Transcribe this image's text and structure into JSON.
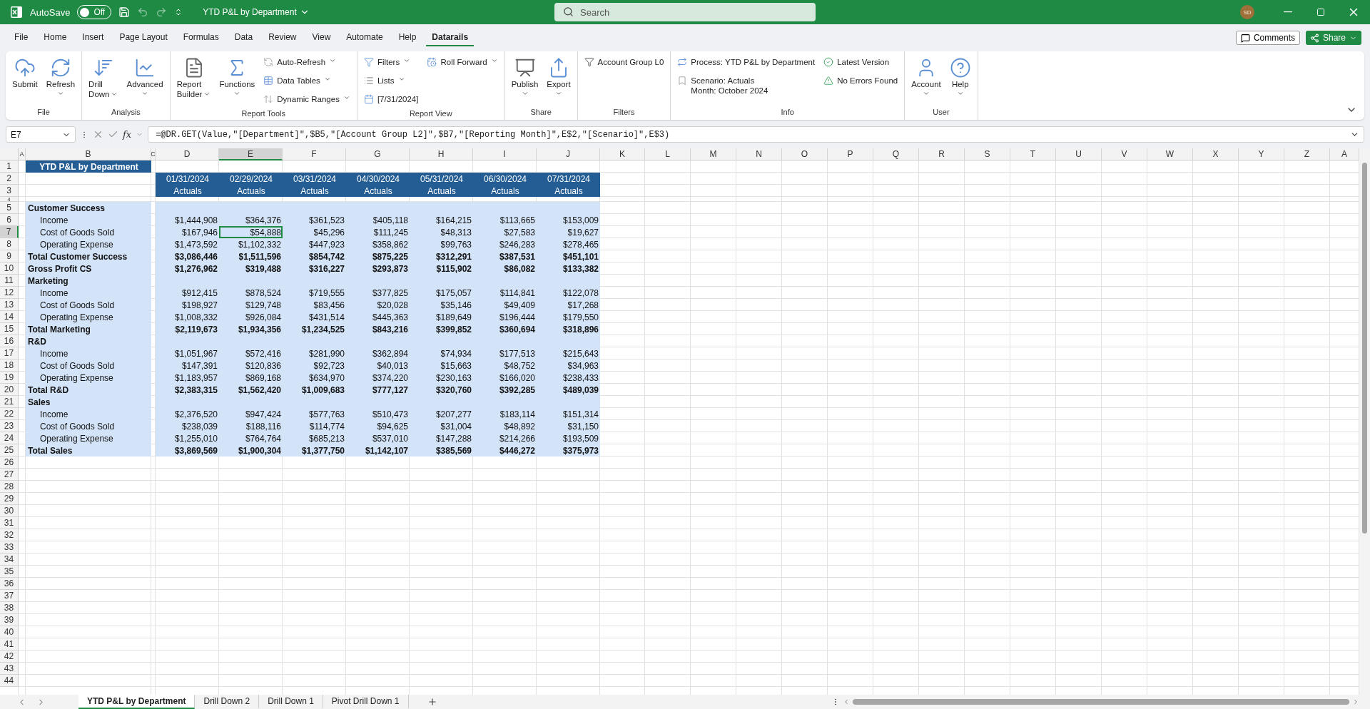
{
  "title_bar": {
    "autosave": {
      "label": "AutoSave",
      "state_text": "Off",
      "on": false
    },
    "document_title": "YTD P&L by Department",
    "search": {
      "placeholder": "Search"
    },
    "user_initials": "SD"
  },
  "menu_tabs": [
    {
      "label": "File",
      "selected": false
    },
    {
      "label": "Home",
      "selected": false
    },
    {
      "label": "Insert",
      "selected": false
    },
    {
      "label": "Page Layout",
      "selected": false
    },
    {
      "label": "Formulas",
      "selected": false
    },
    {
      "label": "Data",
      "selected": false
    },
    {
      "label": "Review",
      "selected": false
    },
    {
      "label": "View",
      "selected": false
    },
    {
      "label": "Automate",
      "selected": false
    },
    {
      "label": "Help",
      "selected": false
    },
    {
      "label": "Datarails",
      "selected": true
    }
  ],
  "comments_button": "Comments",
  "share_button": "Share",
  "ribbon": [
    {
      "label": "File",
      "columns": [
        [
          {
            "kind": "large",
            "lines": [
              "Submit"
            ],
            "dropdown": false
          }
        ],
        [
          {
            "kind": "large",
            "lines": [
              "Refresh"
            ],
            "dropdown": true
          }
        ]
      ]
    },
    {
      "label": "Analysis",
      "columns": [
        [
          {
            "kind": "large",
            "lines": [
              "Drill",
              "Down"
            ],
            "dropdown": true
          }
        ],
        [
          {
            "kind": "large",
            "lines": [
              "Advanced"
            ],
            "dropdown": true
          }
        ]
      ]
    },
    {
      "label": "Report Tools",
      "columns": [
        [
          {
            "kind": "large",
            "lines": [
              "Report",
              "Builder"
            ],
            "dropdown": true
          }
        ],
        [
          {
            "kind": "large",
            "lines": [
              "Functions"
            ],
            "dropdown": true
          }
        ],
        [
          {
            "kind": "small",
            "lines": [
              "Auto-Refresh"
            ],
            "dropdown": true
          },
          {
            "kind": "small",
            "lines": [
              "Data Tables"
            ],
            "dropdown": true
          },
          {
            "kind": "small",
            "lines": [
              "Dynamic Ranges"
            ],
            "dropdown": true
          }
        ]
      ]
    },
    {
      "label": "Report View",
      "columns": [
        [
          {
            "kind": "small",
            "lines": [
              "Filters"
            ],
            "dropdown": true
          },
          {
            "kind": "small",
            "lines": [
              "Lists"
            ],
            "dropdown": true
          },
          {
            "kind": "small",
            "lines": [
              "[7/31/2024]"
            ],
            "dropdown": false
          }
        ],
        [
          {
            "kind": "small",
            "lines": [
              "Roll Forward"
            ],
            "dropdown": true
          }
        ]
      ]
    },
    {
      "label": "Share",
      "columns": [
        [
          {
            "kind": "large",
            "lines": [
              "Publish"
            ],
            "dropdown": true
          }
        ],
        [
          {
            "kind": "large",
            "lines": [
              "Export"
            ],
            "dropdown": true
          }
        ]
      ]
    },
    {
      "label": "Filters",
      "columns": [
        [
          {
            "kind": "small",
            "lines": [
              "Account Group L0"
            ],
            "dropdown": false
          }
        ]
      ]
    },
    {
      "label": "Info",
      "columns": [
        [
          {
            "kind": "info",
            "lines": [
              "Process: YTD P&L by Department"
            ],
            "dropdown": false
          },
          {
            "kind": "info",
            "lines": [
              "Scenario: Actuals",
              "Month: October 2024"
            ],
            "dropdown": false
          }
        ],
        [
          {
            "kind": "info",
            "lines": [
              "Latest Version"
            ],
            "dropdown": false
          },
          {
            "kind": "info",
            "lines": [
              "No Errors Found"
            ],
            "dropdown": false
          }
        ]
      ]
    },
    {
      "label": "User",
      "columns": [
        [
          {
            "kind": "large",
            "lines": [
              "Account"
            ],
            "dropdown": true
          }
        ],
        [
          {
            "kind": "large",
            "lines": [
              "Help"
            ],
            "dropdown": true
          }
        ]
      ]
    }
  ],
  "formula_bar": {
    "name_box": "E7",
    "function_label": "fx",
    "formula": "=@DR.GET(Value,\"[Department]\",$B5,\"[Account Group L2]\",$B7,\"[Reporting Month]\",E$2,\"[Scenario]\",E$3)"
  },
  "sheet": {
    "columns": [
      {
        "label": "A",
        "selected": false
      },
      {
        "label": "B",
        "selected": false
      },
      {
        "label": "C",
        "selected": false
      },
      {
        "label": "D",
        "selected": false
      },
      {
        "label": "E",
        "selected": true
      },
      {
        "label": "F",
        "selected": false
      },
      {
        "label": "G",
        "selected": false
      },
      {
        "label": "H",
        "selected": false
      },
      {
        "label": "I",
        "selected": false
      },
      {
        "label": "J",
        "selected": false
      },
      {
        "label": "K",
        "selected": false
      },
      {
        "label": "L",
        "selected": false
      },
      {
        "label": "M",
        "selected": false
      },
      {
        "label": "N",
        "selected": false
      },
      {
        "label": "O",
        "selected": false
      },
      {
        "label": "P",
        "selected": false
      },
      {
        "label": "Q",
        "selected": false
      },
      {
        "label": "R",
        "selected": false
      },
      {
        "label": "S",
        "selected": false
      },
      {
        "label": "T",
        "selected": false
      },
      {
        "label": "U",
        "selected": false
      },
      {
        "label": "V",
        "selected": false
      },
      {
        "label": "W",
        "selected": false
      },
      {
        "label": "X",
        "selected": false
      },
      {
        "label": "Y",
        "selected": false
      },
      {
        "label": "Z",
        "selected": false
      },
      {
        "label": "A",
        "selected": false
      }
    ],
    "rows": [
      {
        "number": "1",
        "selected": false,
        "kind": "title",
        "label": "YTD P&L by Department"
      },
      {
        "number": "2",
        "selected": false,
        "kind": "header",
        "values": [
          "01/31/2024",
          "02/29/2024",
          "03/31/2024",
          "04/30/2024",
          "05/31/2024",
          "06/30/2024",
          "07/31/2024"
        ]
      },
      {
        "number": "3",
        "selected": false,
        "kind": "header",
        "values": [
          "Actuals",
          "Actuals",
          "Actuals",
          "Actuals",
          "Actuals",
          "Actuals",
          "Actuals"
        ]
      },
      {
        "number": "4",
        "selected": false,
        "kind": "spacer"
      },
      {
        "number": "5",
        "selected": false,
        "kind": "section",
        "label": "Customer Success"
      },
      {
        "number": "6",
        "selected": false,
        "kind": "line",
        "label": "Income",
        "values": [
          "$1,444,908",
          "$364,376",
          "$361,523",
          "$405,118",
          "$164,215",
          "$113,665",
          "$153,009"
        ]
      },
      {
        "number": "7",
        "selected": true,
        "kind": "line",
        "label": "Cost of Goods Sold",
        "values": [
          "$167,946",
          "$54,888",
          "$45,296",
          "$111,245",
          "$48,313",
          "$27,583",
          "$19,627"
        ]
      },
      {
        "number": "8",
        "selected": false,
        "kind": "line",
        "label": "Operating Expense",
        "values": [
          "$1,473,592",
          "$1,102,332",
          "$447,923",
          "$358,862",
          "$99,763",
          "$246,283",
          "$278,465"
        ]
      },
      {
        "number": "9",
        "selected": false,
        "kind": "total",
        "label": "Total Customer Success",
        "values": [
          "$3,086,446",
          "$1,511,596",
          "$854,742",
          "$875,225",
          "$312,291",
          "$387,531",
          "$451,101"
        ]
      },
      {
        "number": "10",
        "selected": false,
        "kind": "total",
        "label": "Gross Profit CS",
        "values": [
          "$1,276,962",
          "$319,488",
          "$316,227",
          "$293,873",
          "$115,902",
          "$86,082",
          "$133,382"
        ]
      },
      {
        "number": "11",
        "selected": false,
        "kind": "section",
        "label": "Marketing"
      },
      {
        "number": "12",
        "selected": false,
        "kind": "line",
        "label": "Income",
        "values": [
          "$912,415",
          "$878,524",
          "$719,555",
          "$377,825",
          "$175,057",
          "$114,841",
          "$122,078"
        ]
      },
      {
        "number": "13",
        "selected": false,
        "kind": "line",
        "label": "Cost of Goods Sold",
        "values": [
          "$198,927",
          "$129,748",
          "$83,456",
          "$20,028",
          "$35,146",
          "$49,409",
          "$17,268"
        ]
      },
      {
        "number": "14",
        "selected": false,
        "kind": "line",
        "label": "Operating Expense",
        "values": [
          "$1,008,332",
          "$926,084",
          "$431,514",
          "$445,363",
          "$189,649",
          "$196,444",
          "$179,550"
        ]
      },
      {
        "number": "15",
        "selected": false,
        "kind": "total",
        "label": "Total Marketing",
        "values": [
          "$2,119,673",
          "$1,934,356",
          "$1,234,525",
          "$843,216",
          "$399,852",
          "$360,694",
          "$318,896"
        ]
      },
      {
        "number": "16",
        "selected": false,
        "kind": "section",
        "label": "R&D"
      },
      {
        "number": "17",
        "selected": false,
        "kind": "line",
        "label": "Income",
        "values": [
          "$1,051,967",
          "$572,416",
          "$281,990",
          "$362,894",
          "$74,934",
          "$177,513",
          "$215,643"
        ]
      },
      {
        "number": "18",
        "selected": false,
        "kind": "line",
        "label": "Cost of Goods Sold",
        "values": [
          "$147,391",
          "$120,836",
          "$92,723",
          "$40,013",
          "$15,663",
          "$48,752",
          "$34,963"
        ]
      },
      {
        "number": "19",
        "selected": false,
        "kind": "line",
        "label": "Operating Expense",
        "values": [
          "$1,183,957",
          "$869,168",
          "$634,970",
          "$374,220",
          "$230,163",
          "$166,020",
          "$238,433"
        ]
      },
      {
        "number": "20",
        "selected": false,
        "kind": "total",
        "label": "Total R&D",
        "values": [
          "$2,383,315",
          "$1,562,420",
          "$1,009,683",
          "$777,127",
          "$320,760",
          "$392,285",
          "$489,039"
        ]
      },
      {
        "number": "21",
        "selected": false,
        "kind": "section",
        "label": "Sales"
      },
      {
        "number": "22",
        "selected": false,
        "kind": "line",
        "label": "Income",
        "values": [
          "$2,376,520",
          "$947,424",
          "$577,763",
          "$510,473",
          "$207,277",
          "$183,114",
          "$151,314"
        ]
      },
      {
        "number": "23",
        "selected": false,
        "kind": "line",
        "label": "Cost of Goods Sold",
        "values": [
          "$238,039",
          "$188,116",
          "$114,774",
          "$94,625",
          "$31,004",
          "$48,892",
          "$31,150"
        ]
      },
      {
        "number": "24",
        "selected": false,
        "kind": "line",
        "label": "Operating Expense",
        "values": [
          "$1,255,010",
          "$764,764",
          "$685,213",
          "$537,010",
          "$147,288",
          "$214,266",
          "$193,509"
        ]
      },
      {
        "number": "25",
        "selected": false,
        "kind": "total",
        "label": "Total Sales",
        "values": [
          "$3,869,569",
          "$1,900,304",
          "$1,377,750",
          "$1,142,107",
          "$385,569",
          "$446,272",
          "$375,973"
        ]
      },
      {
        "number": "26",
        "selected": false,
        "kind": "empty"
      },
      {
        "number": "27",
        "selected": false,
        "kind": "empty"
      },
      {
        "number": "28",
        "selected": false,
        "kind": "empty"
      },
      {
        "number": "29",
        "selected": false,
        "kind": "empty"
      },
      {
        "number": "30",
        "selected": false,
        "kind": "empty"
      },
      {
        "number": "31",
        "selected": false,
        "kind": "empty"
      },
      {
        "number": "32",
        "selected": false,
        "kind": "empty"
      },
      {
        "number": "33",
        "selected": false,
        "kind": "empty"
      },
      {
        "number": "34",
        "selected": false,
        "kind": "empty"
      },
      {
        "number": "35",
        "selected": false,
        "kind": "empty"
      },
      {
        "number": "36",
        "selected": false,
        "kind": "empty"
      },
      {
        "number": "37",
        "selected": false,
        "kind": "empty"
      },
      {
        "number": "38",
        "selected": false,
        "kind": "empty"
      },
      {
        "number": "39",
        "selected": false,
        "kind": "empty"
      },
      {
        "number": "40",
        "selected": false,
        "kind": "empty"
      },
      {
        "number": "41",
        "selected": false,
        "kind": "empty"
      },
      {
        "number": "42",
        "selected": false,
        "kind": "empty"
      },
      {
        "number": "43",
        "selected": false,
        "kind": "empty"
      },
      {
        "number": "44",
        "selected": false,
        "kind": "empty"
      }
    ]
  },
  "sheet_tabs": [
    {
      "label": "YTD P&L by Department",
      "selected": true
    },
    {
      "label": "Drill Down 2",
      "selected": false
    },
    {
      "label": "Drill Down 1",
      "selected": false
    },
    {
      "label": "Pivot Drill Down 1",
      "selected": false
    }
  ]
}
